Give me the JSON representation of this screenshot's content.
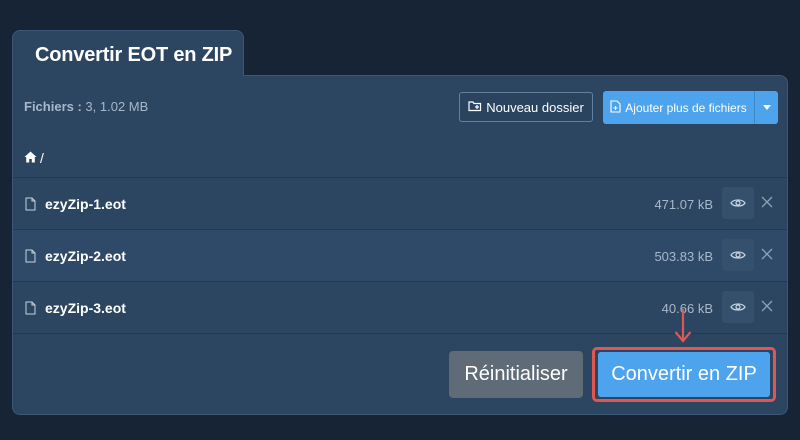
{
  "panel": {
    "title": "Convertir EOT en ZIP"
  },
  "toolbar": {
    "files_label": "Fichiers :",
    "files_summary": "3, 1.02 MB",
    "new_folder_label": "Nouveau dossier",
    "add_files_label": "Ajouter plus de fichiers"
  },
  "breadcrumb": {
    "icon": "home-icon",
    "separator": "/"
  },
  "files": [
    {
      "name": "ezyZip-1.eot",
      "size": "471.07 kB"
    },
    {
      "name": "ezyZip-2.eot",
      "size": "503.83 kB"
    },
    {
      "name": "ezyZip-3.eot",
      "size": "40.66 kB"
    }
  ],
  "actions": {
    "reset_label": "Réinitialiser",
    "convert_label": "Convertir en ZIP"
  },
  "colors": {
    "background": "#162435",
    "panel": "#2c4561",
    "primary": "#4da3ec",
    "reset": "#5f6b77",
    "highlight": "#e05652"
  }
}
